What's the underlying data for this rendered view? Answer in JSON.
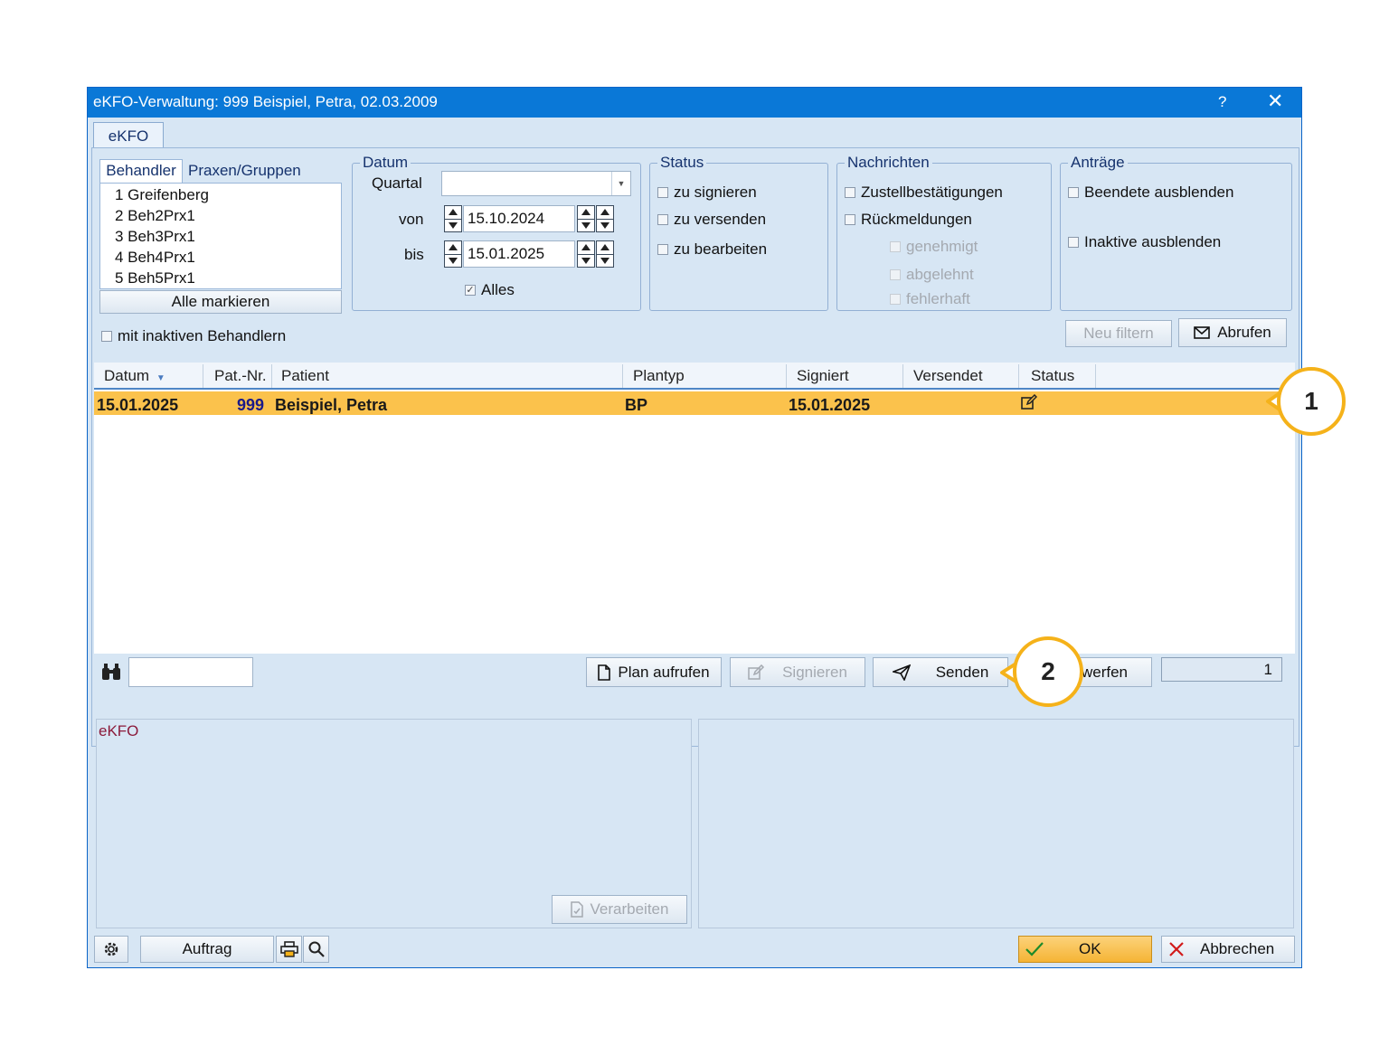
{
  "window": {
    "title": "eKFO-Verwaltung: 999 Beispiel, Petra, 02.03.2009",
    "help": "?",
    "close": "✕"
  },
  "main_tab": "eKFO",
  "behandler": {
    "tabs": [
      "Behandler",
      "Praxen/Gruppen"
    ],
    "items": [
      "1 Greifenberg",
      "2 Beh2Prx1",
      "3 Beh3Prx1",
      "4 Beh4Prx1",
      "5 Beh5Prx1"
    ],
    "mark_all": "Alle markieren",
    "inactive_label": "mit inaktiven Behandlern"
  },
  "datum": {
    "title": "Datum",
    "quartal_label": "Quartal",
    "quartal_value": "",
    "von_label": "von",
    "von_value": "15.10.2024",
    "bis_label": "bis",
    "bis_value": "15.01.2025",
    "alles_label": "Alles",
    "alles_checked": true
  },
  "status": {
    "title": "Status",
    "items": [
      "zu signieren",
      "zu versenden",
      "zu bearbeiten"
    ]
  },
  "nachrichten": {
    "title": "Nachrichten",
    "items": [
      "Zustellbestätigungen",
      "Rückmeldungen"
    ],
    "sub_items": [
      "genehmigt",
      "abgelehnt",
      "fehlerhaft"
    ]
  },
  "antraege": {
    "title": "Anträge",
    "items": [
      "Beendete ausblenden",
      "Inaktive ausblenden"
    ]
  },
  "filter_buttons": {
    "neu_filtern": "Neu filtern",
    "abrufen": "Abrufen"
  },
  "table": {
    "columns": [
      "Datum",
      "Pat.-Nr.",
      "Patient",
      "Plantyp",
      "Signiert",
      "Versendet",
      "Status"
    ],
    "sort_indicator": "▼",
    "rows": [
      {
        "datum": "15.01.2025",
        "patnr": "999",
        "patient": "Beispiel, Petra",
        "plantyp": "BP",
        "signiert": "15.01.2025",
        "versendet": "",
        "status_icon": "edit-icon"
      }
    ]
  },
  "actions": {
    "search_value": "",
    "plan_aufrufen": "Plan aufrufen",
    "signieren": "Signieren",
    "senden": "Senden",
    "verwerfen_partial": "werfen",
    "counter": "1"
  },
  "lower_left": {
    "label": "eKFO",
    "verarbeiten": "Verarbeiten"
  },
  "footer": {
    "auftrag": "Auftrag",
    "ok": "OK",
    "abbrechen": "Abbrechen"
  },
  "callouts": [
    "1",
    "2"
  ],
  "colors": {
    "titlebar": "#0a78d7",
    "selected_row": "#fbc24c",
    "callout": "#f5b21a",
    "ok_button": "#fbc24c",
    "ekfo_label": "#8b1a3a"
  }
}
